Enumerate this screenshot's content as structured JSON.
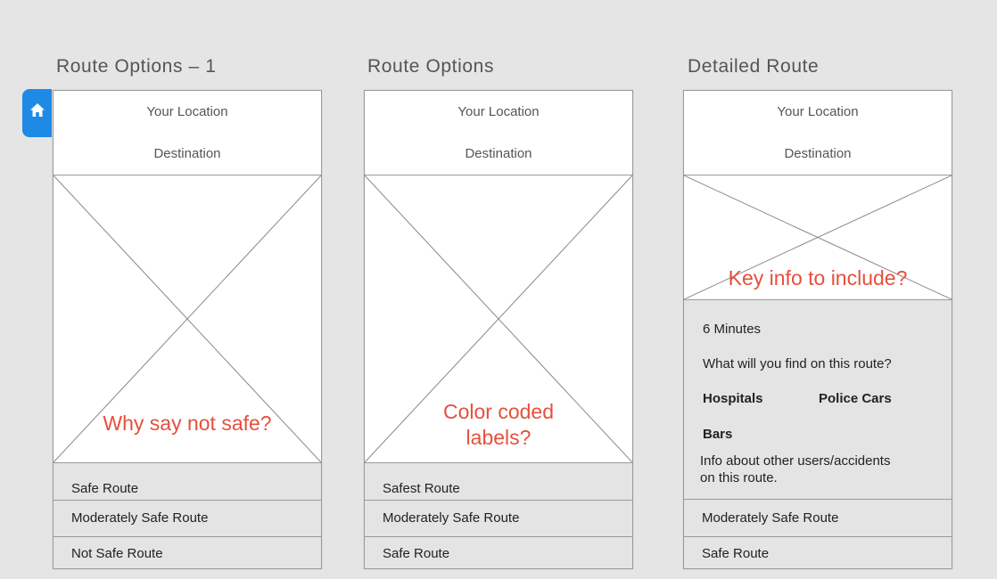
{
  "screens": [
    {
      "title": "Route Options – 1",
      "your_location": "Your Location",
      "destination": "Destination",
      "note": "Why say not safe?",
      "options": [
        "Safe Route",
        "Moderately Safe Route",
        "Not Safe Route"
      ]
    },
    {
      "title": "Route Options",
      "your_location": "Your Location",
      "destination": "Destination",
      "note_line1": "Color coded",
      "note_line2": "labels?",
      "options": [
        "Safest Route",
        "Moderately Safe Route",
        "Safe Route"
      ]
    },
    {
      "title": "Detailed Route",
      "your_location": "Your Location",
      "destination": "Destination",
      "note": "Key info to include?",
      "details": {
        "duration": "6 Minutes",
        "question": "What will you find on this route?",
        "items": [
          "Hospitals",
          "Police Cars",
          "Bars"
        ],
        "info_line1": "Info about other users/accidents",
        "info_line2": "on this route."
      },
      "options": [
        "Moderately Safe Route",
        "Safe Route"
      ]
    }
  ],
  "home_icon": "home-icon",
  "colors": {
    "accent": "#1e8ae6",
    "note": "#e5503c",
    "option_bg": "#e4e4e4"
  }
}
